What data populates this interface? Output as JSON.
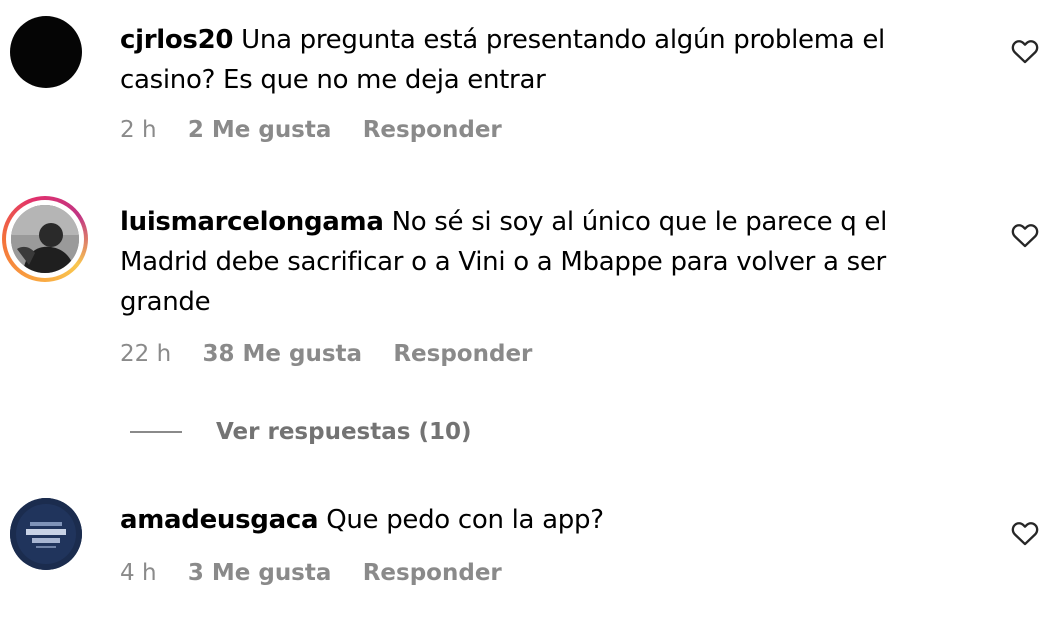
{
  "comments": [
    {
      "username": "cjrlos20",
      "text": "Una pregunta está presentando algún problema el casino? Es que no me deja entrar",
      "time": "2 h",
      "likes": "2 Me gusta",
      "reply": "Responder",
      "avatar": "black-avatar"
    },
    {
      "username": "luismarcelongama",
      "text": "No sé si soy al único que le parece q el Madrid debe sacrificar o a Vini o a Mbappe para volver a ser grande",
      "time": "22 h",
      "likes": "38 Me gusta",
      "reply": "Responder",
      "avatar": "photo-avatar-story-ring",
      "view_replies": "Ver respuestas (10)"
    },
    {
      "username": "amadeusgaca",
      "text": "Que pedo con la app?",
      "time": "4 h",
      "likes": "3 Me gusta",
      "reply": "Responder",
      "avatar": "event-logo-avatar"
    }
  ],
  "icons": {
    "like": "heart-outline-icon"
  },
  "colors": {
    "meta_text": "#8a8a8a",
    "story_ring": [
      "#f9a03f",
      "#e1306c",
      "#c13584"
    ]
  }
}
